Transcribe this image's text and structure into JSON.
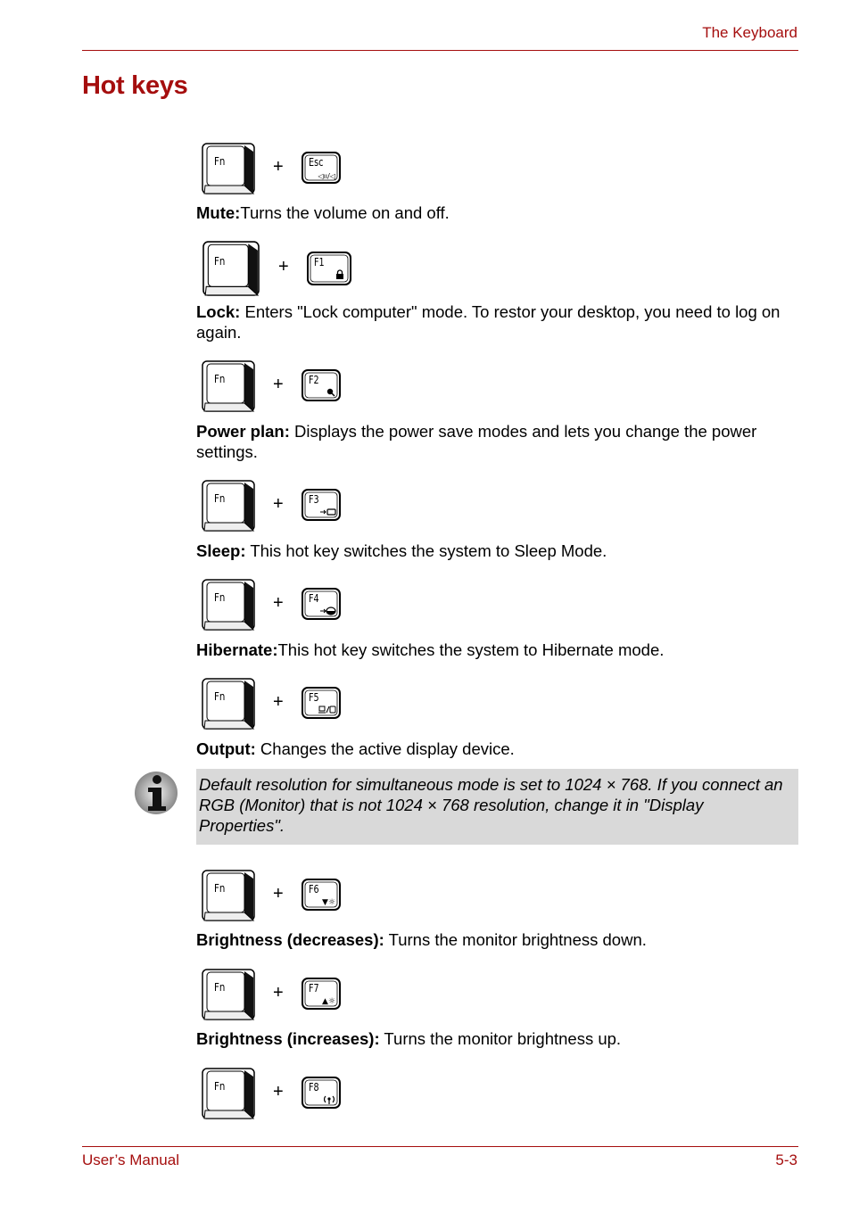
{
  "header": {
    "section_title": "The Keyboard"
  },
  "page_title": "Hot keys",
  "hotkeys": [
    {
      "fn": "Fn",
      "plus": "+",
      "key": "Esc",
      "glyph": "🔈/🔇",
      "label": "Mute:",
      "text": "Turns the volume on and off."
    },
    {
      "fn": "Fn",
      "plus": "+",
      "key": "F1",
      "glyph": "🔒",
      "label": "Lock:",
      "text": " Enters \"Lock computer\" mode. To restor your desktop, you need to log on again."
    },
    {
      "fn": "Fn",
      "plus": "+",
      "key": "F2",
      "glyph": "●",
      "label": "Power plan:",
      "text": " Displays the power save modes and lets you change the power settings."
    },
    {
      "fn": "Fn",
      "plus": "+",
      "key": "F3",
      "glyph": "→▭",
      "label": "Sleep:",
      "text": " This hot key switches the system to Sleep Mode."
    },
    {
      "fn": "Fn",
      "plus": "+",
      "key": "F4",
      "glyph": "→◒",
      "label": "Hibernate:",
      "text": "This hot key switches the system to Hibernate mode."
    },
    {
      "fn": "Fn",
      "plus": "+",
      "key": "F5",
      "glyph": "▭/▢",
      "label": "Output:",
      "text": " Changes the active display device."
    },
    {
      "fn": "Fn",
      "plus": "+",
      "key": "F6",
      "glyph": "▼☼",
      "label": "Brightness (decreases):",
      "text": " Turns the monitor brightness down."
    },
    {
      "fn": "Fn",
      "plus": "+",
      "key": "F7",
      "glyph": "▲☼",
      "label": "Brightness (increases):",
      "text": " Turns the monitor brightness up."
    },
    {
      "fn": "Fn",
      "plus": "+",
      "key": "F8",
      "glyph": "((•))",
      "label": "",
      "text": ""
    }
  ],
  "note": {
    "icon": "info-icon",
    "text": "Default resolution for simultaneous mode is set to 1024 × 768. If you connect an RGB (Monitor) that is not 1024 × 768 resolution, change it in \"Display Properties\"."
  },
  "footer": {
    "left": "User’s Manual",
    "right": "5-3"
  }
}
